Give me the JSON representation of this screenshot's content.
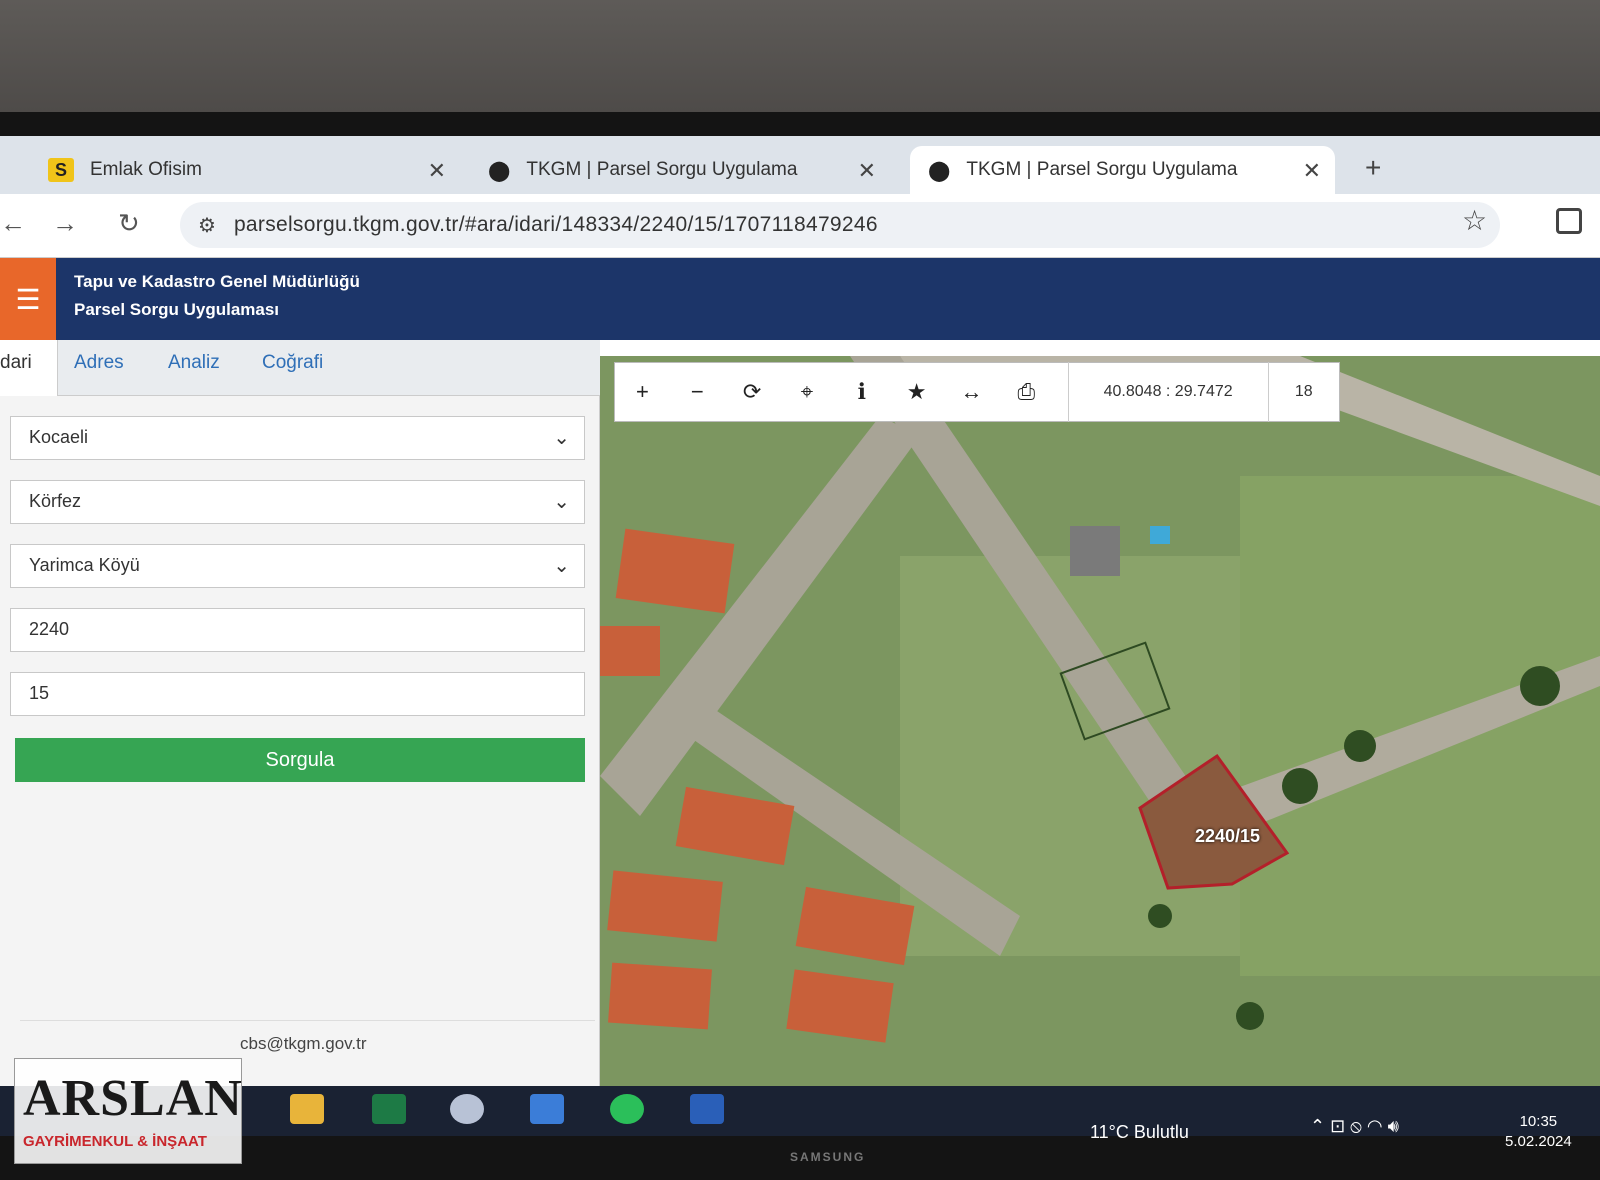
{
  "browser": {
    "tabs": [
      {
        "label": "Emlak Ofisim",
        "icon": "S"
      },
      {
        "label": "TKGM | Parsel Sorgu Uygulama"
      },
      {
        "label": "TKGM | Parsel Sorgu Uygulama"
      }
    ],
    "url": "parselsorgu.tkgm.gov.tr/#ara/idari/148334/2240/15/1707118479246"
  },
  "app": {
    "title_line1": "Tapu ve Kadastro Genel Müdürlüğü",
    "title_line2": "Parsel Sorgu Uygulaması"
  },
  "panel": {
    "tabs": [
      "dari",
      "Adres",
      "Analiz",
      "Coğrafi"
    ],
    "province": "Kocaeli",
    "district": "Körfez",
    "neighborhood": "Yarimca Köyü",
    "ada": "2240",
    "parsel": "15",
    "query_button": "Sorgula",
    "contact": "cbs@tkgm.gov.tr"
  },
  "map": {
    "coordinates": "40.8048 : 29.7472",
    "zoom": "18",
    "parcel_label": "2240/15",
    "parcel_color": "#b3202a"
  },
  "taskbar": {
    "weather": "11°C  Bulutlu",
    "time": "10:35",
    "date": "5.02.2024"
  },
  "monitor_brand": "SAMSUNG",
  "watermark": {
    "brand": "ARSLAN",
    "tagline": "GAYRİMENKUL & İNŞAAT"
  }
}
